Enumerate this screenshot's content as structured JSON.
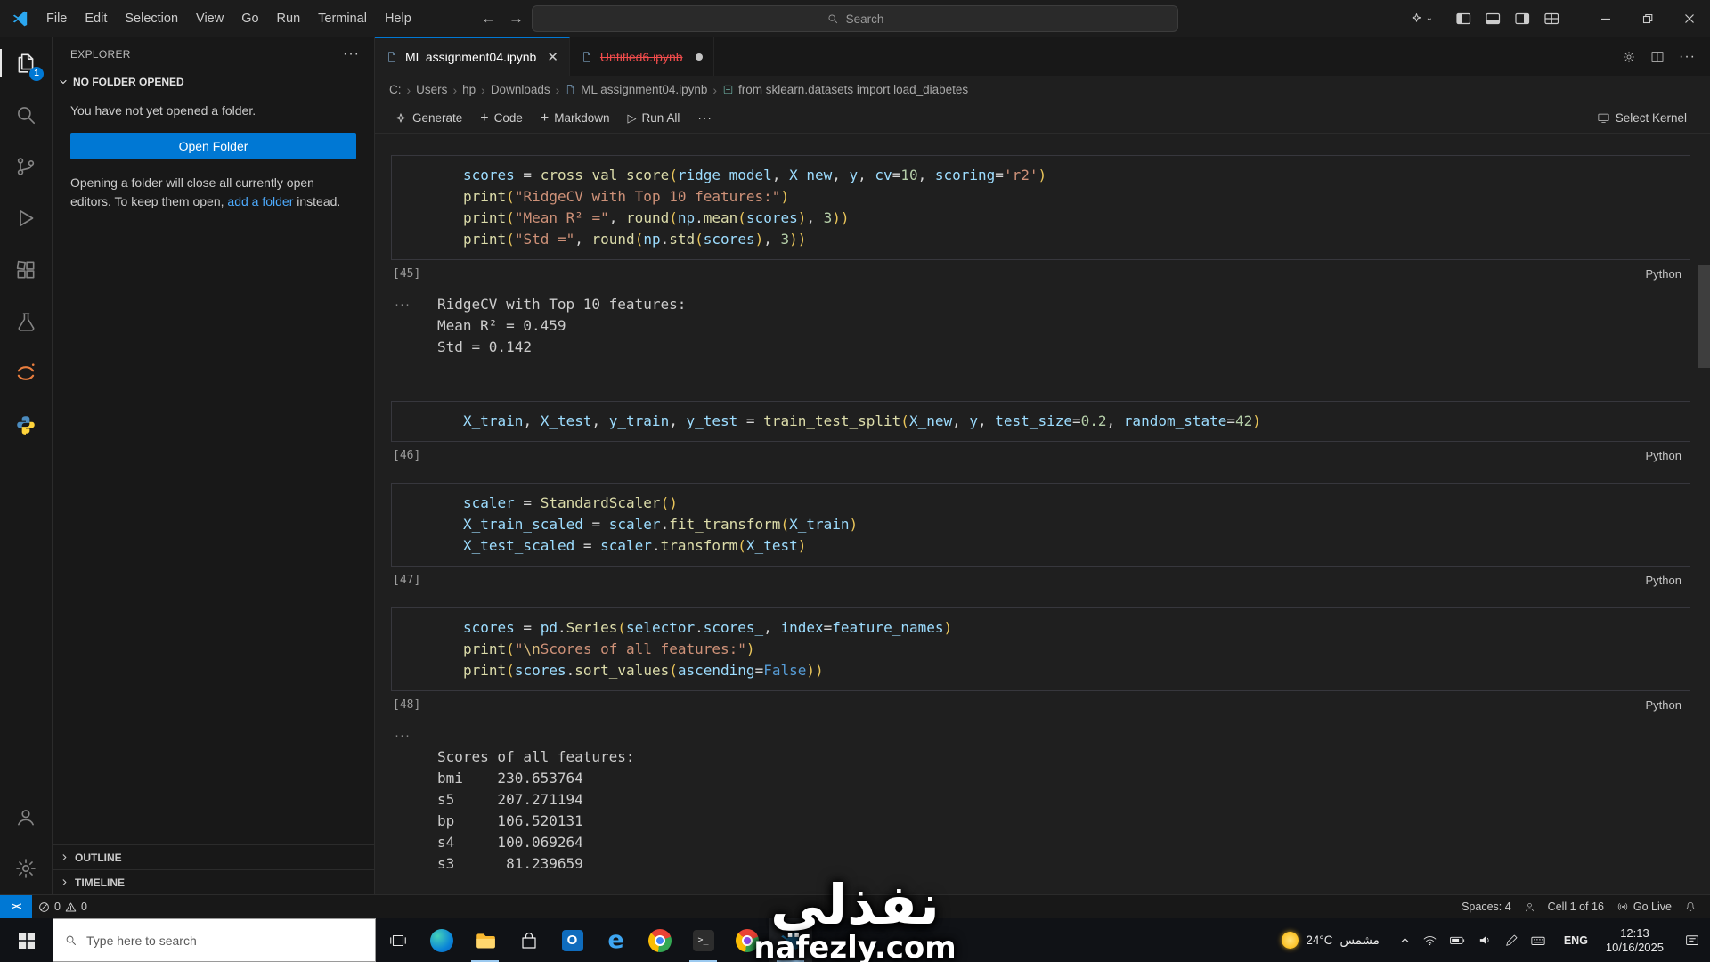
{
  "window": {
    "menus": [
      "File",
      "Edit",
      "Selection",
      "View",
      "Go",
      "Run",
      "Terminal",
      "Help"
    ],
    "search_placeholder": "Search"
  },
  "activitybar": {
    "explorer_badge": "1"
  },
  "sidebar": {
    "title": "EXPLORER",
    "section": "NO FOLDER OPENED",
    "empty_text": "You have not yet opened a folder.",
    "open_folder_label": "Open Folder",
    "note_before": "Opening a folder will close all currently open editors. To keep them open, ",
    "note_link": "add a folder",
    "note_after": " instead.",
    "outline_label": "OUTLINE",
    "timeline_label": "TIMELINE"
  },
  "tabs": [
    {
      "label": "ML assignment04.ipynb"
    },
    {
      "label": "Untitled6.ipynb"
    }
  ],
  "breadcrumbs": [
    "C:",
    "Users",
    "hp",
    "Downloads",
    "ML assignment04.ipynb",
    "from sklearn.datasets import load_diabetes"
  ],
  "toolbar": {
    "generate": "Generate",
    "code": "Code",
    "markdown": "Markdown",
    "run_all": "Run All",
    "select_kernel": "Select Kernel"
  },
  "notebook": {
    "cells": [
      {
        "kind": "code",
        "exec": "[45]",
        "lang": "Python",
        "lines": [
          [
            [
              "v",
              "scores"
            ],
            [
              "d",
              " = "
            ],
            [
              "f",
              "cross_val_score"
            ],
            [
              "g",
              "("
            ],
            [
              "v",
              "ridge_model"
            ],
            [
              "d",
              ", "
            ],
            [
              "v",
              "X_new"
            ],
            [
              "d",
              ", "
            ],
            [
              "v",
              "y"
            ],
            [
              "d",
              ", "
            ],
            [
              "v",
              "cv"
            ],
            [
              "d",
              "="
            ],
            [
              "n",
              "10"
            ],
            [
              "d",
              ", "
            ],
            [
              "v",
              "scoring"
            ],
            [
              "d",
              "="
            ],
            [
              "s",
              "'r2'"
            ],
            [
              "g",
              ")"
            ]
          ],
          [
            [
              "f",
              "print"
            ],
            [
              "g",
              "("
            ],
            [
              "s",
              "\"RidgeCV with Top 10 features:\""
            ],
            [
              "g",
              ")"
            ]
          ],
          [
            [
              "f",
              "print"
            ],
            [
              "g",
              "("
            ],
            [
              "s",
              "\"Mean R² =\""
            ],
            [
              "d",
              ", "
            ],
            [
              "f",
              "round"
            ],
            [
              "g",
              "("
            ],
            [
              "v",
              "np"
            ],
            [
              "d",
              "."
            ],
            [
              "f",
              "mean"
            ],
            [
              "g",
              "("
            ],
            [
              "v",
              "scores"
            ],
            [
              "g",
              ")"
            ],
            [
              "d",
              ", "
            ],
            [
              "n",
              "3"
            ],
            [
              "g",
              "))"
            ]
          ],
          [
            [
              "f",
              "print"
            ],
            [
              "g",
              "("
            ],
            [
              "s",
              "\"Std =\""
            ],
            [
              "d",
              ", "
            ],
            [
              "f",
              "round"
            ],
            [
              "g",
              "("
            ],
            [
              "v",
              "np"
            ],
            [
              "d",
              "."
            ],
            [
              "f",
              "std"
            ],
            [
              "g",
              "("
            ],
            [
              "v",
              "scores"
            ],
            [
              "g",
              ")"
            ],
            [
              "d",
              ", "
            ],
            [
              "n",
              "3"
            ],
            [
              "g",
              "))"
            ]
          ]
        ]
      },
      {
        "kind": "output",
        "lines": [
          "RidgeCV with Top 10 features:",
          "Mean R² = 0.459",
          "Std = 0.142"
        ]
      },
      {
        "kind": "code",
        "exec": "[46]",
        "lang": "Python",
        "lines": [
          [
            [
              "v",
              "X_train"
            ],
            [
              "d",
              ", "
            ],
            [
              "v",
              "X_test"
            ],
            [
              "d",
              ", "
            ],
            [
              "v",
              "y_train"
            ],
            [
              "d",
              ", "
            ],
            [
              "v",
              "y_test"
            ],
            [
              "d",
              " = "
            ],
            [
              "f",
              "train_test_split"
            ],
            [
              "g",
              "("
            ],
            [
              "v",
              "X_new"
            ],
            [
              "d",
              ", "
            ],
            [
              "v",
              "y"
            ],
            [
              "d",
              ", "
            ],
            [
              "v",
              "test_size"
            ],
            [
              "d",
              "="
            ],
            [
              "n",
              "0.2"
            ],
            [
              "d",
              ", "
            ],
            [
              "v",
              "random_state"
            ],
            [
              "d",
              "="
            ],
            [
              "n",
              "42"
            ],
            [
              "g",
              ")"
            ]
          ]
        ]
      },
      {
        "kind": "code",
        "exec": "[47]",
        "lang": "Python",
        "lines": [
          [
            [
              "v",
              "scaler"
            ],
            [
              "d",
              " = "
            ],
            [
              "f",
              "StandardScaler"
            ],
            [
              "g",
              "()"
            ]
          ],
          [
            [
              "v",
              "X_train_scaled"
            ],
            [
              "d",
              " = "
            ],
            [
              "v",
              "scaler"
            ],
            [
              "d",
              "."
            ],
            [
              "f",
              "fit_transform"
            ],
            [
              "g",
              "("
            ],
            [
              "v",
              "X_train"
            ],
            [
              "g",
              ")"
            ]
          ],
          [
            [
              "v",
              "X_test_scaled"
            ],
            [
              "d",
              " = "
            ],
            [
              "v",
              "scaler"
            ],
            [
              "d",
              "."
            ],
            [
              "f",
              "transform"
            ],
            [
              "g",
              "("
            ],
            [
              "v",
              "X_test"
            ],
            [
              "g",
              ")"
            ]
          ]
        ]
      },
      {
        "kind": "code",
        "exec": "[48]",
        "lang": "Python",
        "lines": [
          [
            [
              "v",
              "scores"
            ],
            [
              "d",
              " = "
            ],
            [
              "v",
              "pd"
            ],
            [
              "d",
              "."
            ],
            [
              "f",
              "Series"
            ],
            [
              "g",
              "("
            ],
            [
              "v",
              "selector"
            ],
            [
              "d",
              "."
            ],
            [
              "v",
              "scores_"
            ],
            [
              "d",
              ", "
            ],
            [
              "v",
              "index"
            ],
            [
              "d",
              "="
            ],
            [
              "v",
              "feature_names"
            ],
            [
              "g",
              ")"
            ]
          ],
          [
            [
              "f",
              "print"
            ],
            [
              "g",
              "("
            ],
            [
              "s",
              "\""
            ],
            [
              "e",
              "\\n"
            ],
            [
              "s",
              "Scores of all features:\""
            ],
            [
              "g",
              ")"
            ]
          ],
          [
            [
              "f",
              "print"
            ],
            [
              "g",
              "("
            ],
            [
              "v",
              "scores"
            ],
            [
              "d",
              "."
            ],
            [
              "f",
              "sort_values"
            ],
            [
              "g",
              "("
            ],
            [
              "v",
              "ascending"
            ],
            [
              "d",
              "="
            ],
            [
              "k",
              "False"
            ],
            [
              "g",
              "))"
            ]
          ]
        ]
      },
      {
        "kind": "output",
        "lines": [
          "",
          "Scores of all features:",
          "bmi    230.653764",
          "s5     207.271194",
          "bp     106.520131",
          "s4     100.069264",
          "s3      81.239659"
        ]
      }
    ]
  },
  "statusbar": {
    "errors": "0",
    "warnings": "0",
    "spaces": "Spaces: 4",
    "cell_indicator": "Cell 1 of 16",
    "go_live": "Go Live"
  },
  "taskbar": {
    "search_placeholder": "Type here to search",
    "weather_temp": "24°C",
    "weather_desc": "مشمس",
    "lang": "ENG",
    "time": "12:13",
    "date": "10/16/2025"
  },
  "watermark": {
    "title": "نفذلي",
    "site": "nafezly.com"
  }
}
